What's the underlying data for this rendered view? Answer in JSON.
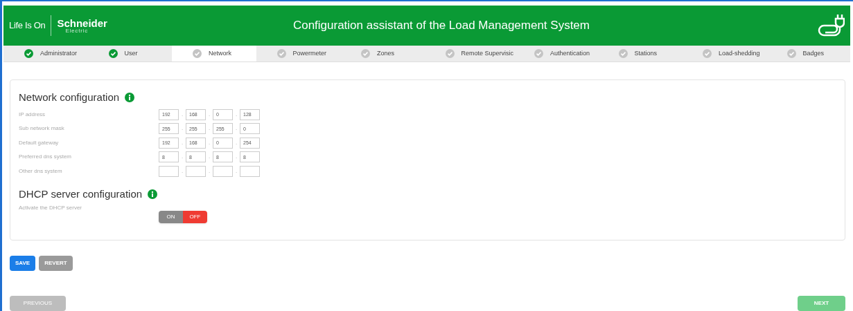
{
  "header": {
    "logo_tagline": "Life Is On",
    "logo_brand": "Schneider",
    "logo_sub": "Electric",
    "title": "Configuration assistant of the Load Management System"
  },
  "steps": [
    {
      "label": "Administrator",
      "done": true,
      "selected": false
    },
    {
      "label": "User",
      "done": true,
      "selected": false
    },
    {
      "label": "Network",
      "done": false,
      "selected": true
    },
    {
      "label": "Powermeter",
      "done": false,
      "selected": false
    },
    {
      "label": "Zones",
      "done": false,
      "selected": false
    },
    {
      "label": "Remote Supervisic",
      "done": false,
      "selected": false
    },
    {
      "label": "Authentication",
      "done": false,
      "selected": false
    },
    {
      "label": "Stations",
      "done": false,
      "selected": false
    },
    {
      "label": "Load-shedding",
      "done": false,
      "selected": false
    },
    {
      "label": "Badges",
      "done": false,
      "selected": false
    }
  ],
  "network": {
    "heading": "Network configuration",
    "fields": [
      {
        "label": "IP address",
        "octets": [
          "192",
          "168",
          "0",
          "128"
        ]
      },
      {
        "label": "Sub network mask",
        "octets": [
          "255",
          "255",
          "255",
          "0"
        ]
      },
      {
        "label": "Default gateway",
        "octets": [
          "192",
          "168",
          "0",
          "254"
        ]
      },
      {
        "label": "Preferred dns system",
        "octets": [
          "8",
          "8",
          "8",
          "8"
        ]
      },
      {
        "label": "Other dns system"
      }
    ],
    "separator": "."
  },
  "dhcp": {
    "heading": "DHCP server configuration",
    "label": "Activate the DHCP server",
    "on_label": "ON",
    "off_label": "OFF",
    "on": false
  },
  "actions": [
    {
      "label": "SAVE",
      "kind": "primary"
    },
    {
      "label": "REVERT",
      "kind": "secondary"
    }
  ],
  "nav": {
    "previous": {
      "label": "PREVIOUS",
      "disabled": true
    },
    "next": {
      "label": "NEXT",
      "disabled": true
    }
  }
}
